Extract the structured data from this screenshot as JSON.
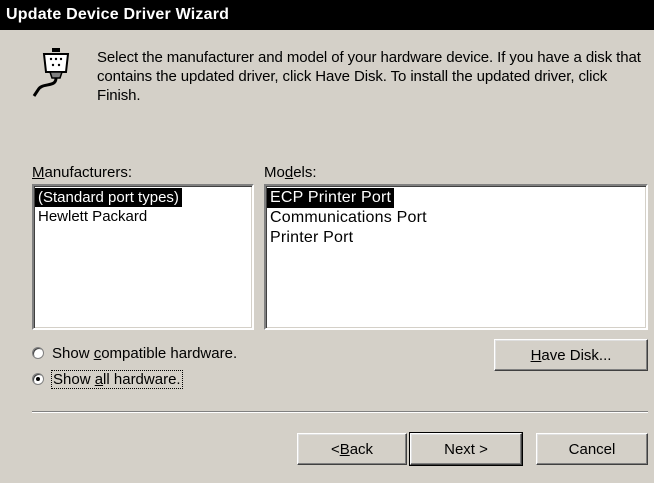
{
  "window": {
    "title": "Update Device Driver Wizard"
  },
  "header": {
    "icon": "serial-port-connector-icon",
    "instructions": "Select the manufacturer and model of your hardware device. If you have a disk that contains the updated driver, click Have Disk. To install the updated driver, click Finish."
  },
  "manufacturers": {
    "label_pre": "",
    "label_key": "M",
    "label_post": "anufacturers:",
    "items": [
      "(Standard port types)",
      "Hewlett Packard"
    ],
    "selected_index": 0
  },
  "models": {
    "label_pre": "Mo",
    "label_key": "d",
    "label_post": "els:",
    "items": [
      "ECP Printer Port",
      "Communications Port",
      "Printer Port"
    ],
    "selected_index": 0
  },
  "options": {
    "compatible": {
      "pre": "Show ",
      "key": "c",
      "post": "ompatible hardware.",
      "checked": false
    },
    "all": {
      "pre": "Show ",
      "key": "a",
      "post": "ll hardware.",
      "checked": true
    }
  },
  "buttons": {
    "have_disk": {
      "key": "H",
      "post": "ave Disk..."
    },
    "back": {
      "pre": "< ",
      "key": "B",
      "post": "ack"
    },
    "next": "Next >",
    "cancel": "Cancel"
  }
}
